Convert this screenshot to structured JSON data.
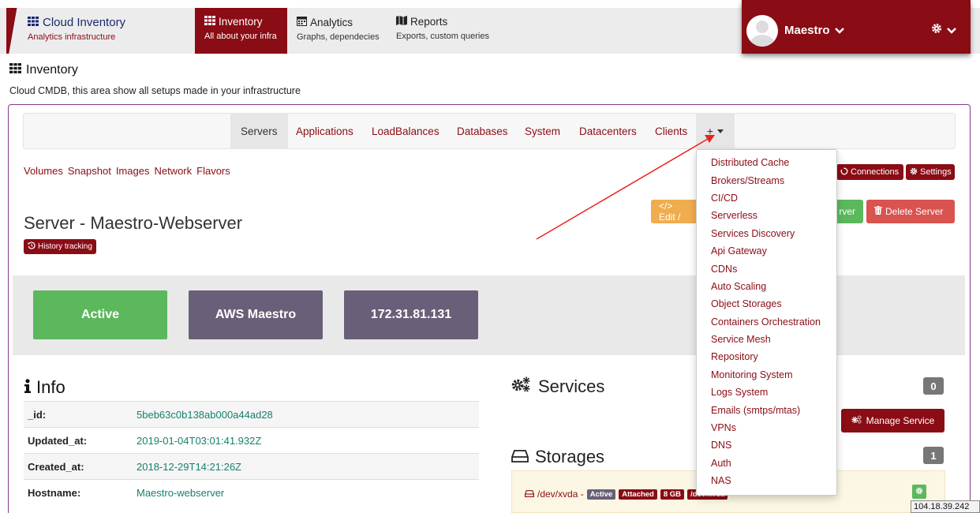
{
  "brand": {
    "title": "Cloud Inventory",
    "subtitle": "Analytics infrastructure"
  },
  "nav": [
    {
      "title": "Inventory",
      "subtitle": "All about your infra"
    },
    {
      "title": "Analytics",
      "subtitle": "Graphs, dependecies"
    },
    {
      "title": "Reports",
      "subtitle": "Exports, custom queries"
    }
  ],
  "user": {
    "name": "Maestro"
  },
  "page": {
    "title": "Inventory",
    "description": "Cloud CMDB, this area show all setups made in your infrastructure"
  },
  "tabs": [
    "Servers",
    "Applications",
    "LoadBalances",
    "Databases",
    "System",
    "Datacenters",
    "Clients",
    "+"
  ],
  "sublinks": [
    "Volumes",
    "Snapshot",
    "Images",
    "Network",
    "Flavors"
  ],
  "toolbar": {
    "connections": "Connections",
    "settings": "Settings",
    "edit": "</> Edit /",
    "server": "rver",
    "delete": "Delete Server"
  },
  "server": {
    "title": "Server - Maestro-Webserver",
    "history": "History tracking"
  },
  "status": {
    "state": "Active",
    "provider": "AWS Maestro",
    "ip": "172.31.81.131"
  },
  "info": {
    "heading": "Info",
    "rows": [
      {
        "key": "_id:",
        "value": "5beb63c0b138ab000a44ad28"
      },
      {
        "key": "Updated_at:",
        "value": "2019-01-04T03:01:41.932Z"
      },
      {
        "key": "Created_at:",
        "value": "2018-12-29T14:21:26Z"
      },
      {
        "key": "Hostname:",
        "value": "Maestro-webserver"
      }
    ]
  },
  "services": {
    "heading": "Services",
    "count": "0",
    "manage": "Manage Service"
  },
  "storages": {
    "heading": "Storages",
    "count": "1",
    "device": "/dev/xvda -",
    "labels": [
      "Active",
      "Attached",
      "8 GB",
      "/dev/xvda"
    ]
  },
  "dropdown": [
    "Distributed Cache",
    "Brokers/Streams",
    "CI/CD",
    "Serverless",
    "Services Discovery",
    "Api Gateway",
    "CDNs",
    "Auto Scaling",
    "Object Storages",
    "Containers Orchestration",
    "Service Mesh",
    "Repository",
    "Monitoring System",
    "Logs System",
    "Emails (smtps/mtas)",
    "VPNs",
    "DNS",
    "Auth",
    "NAS"
  ],
  "tooltip": "104.18.39.242",
  "colors": {
    "brand": "#8a0c15",
    "success": "#5cb85c",
    "warning": "#f0ad4e",
    "danger": "#d9534f",
    "neutral": "#6a5f78"
  },
  "icons": {
    "grid": "grid-icon",
    "calendar": "calendar-icon",
    "map": "map-icon",
    "gear": "gear-icon",
    "history": "history-icon",
    "info": "info-icon",
    "cogs": "cogs-icon",
    "storage": "hdd-icon",
    "trash": "trash-icon",
    "code": "code-icon",
    "circle": "connections-icon"
  }
}
